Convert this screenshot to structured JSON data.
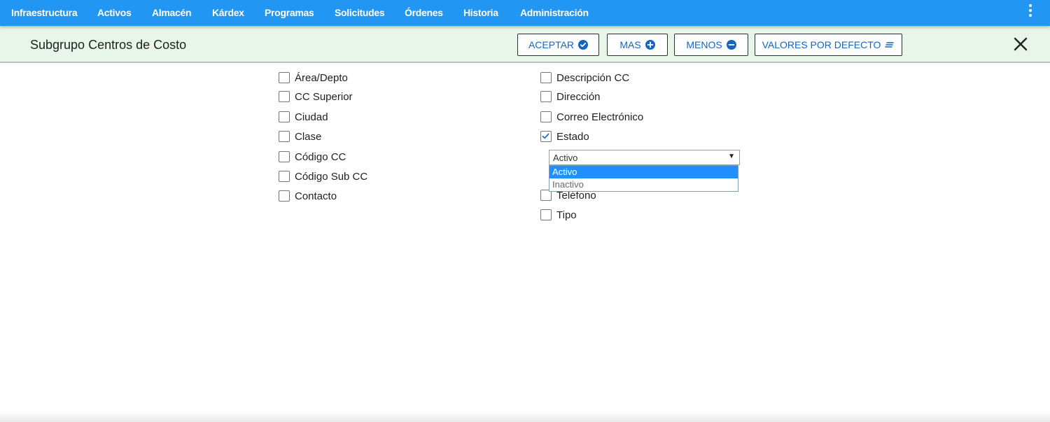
{
  "nav": {
    "items": [
      "Infraestructura",
      "Activos",
      "Almacén",
      "Kárdex",
      "Programas",
      "Solicitudes",
      "Órdenes",
      "Historia",
      "Administración"
    ],
    "more_icon": "kebab-vertical-icon"
  },
  "toolbar": {
    "title": "Subgrupo Centros de Costo",
    "accept_label": "ACEPTAR",
    "more_label": "MAS",
    "less_label": "MENOS",
    "defaults_label": "VALORES POR DEFECTO",
    "close_icon": "close-icon"
  },
  "fields": {
    "left": [
      {
        "label": "Área/Depto",
        "checked": false
      },
      {
        "label": "CC Superior",
        "checked": false
      },
      {
        "label": "Ciudad",
        "checked": false
      },
      {
        "label": "Clase",
        "checked": false
      },
      {
        "label": "Código CC",
        "checked": false
      },
      {
        "label": "Código Sub CC",
        "checked": false
      },
      {
        "label": "Contacto",
        "checked": false
      }
    ],
    "right": [
      {
        "label": "Descripción CC",
        "checked": false
      },
      {
        "label": "Dirección",
        "checked": false
      },
      {
        "label": "Correo Electrónico",
        "checked": false
      },
      {
        "label": "Estado",
        "checked": true
      },
      {
        "label": "Teléfono",
        "checked": false
      },
      {
        "label": "Tipo",
        "checked": false
      }
    ]
  },
  "estado_select": {
    "value": "Activo",
    "options": [
      "Activo",
      "Inactivo"
    ],
    "highlighted": "Activo"
  },
  "colors": {
    "navbar": "#2196f3",
    "toolbar": "#e8f5e9",
    "button_text": "#1565c0",
    "option_highlight": "#1e90ff"
  }
}
